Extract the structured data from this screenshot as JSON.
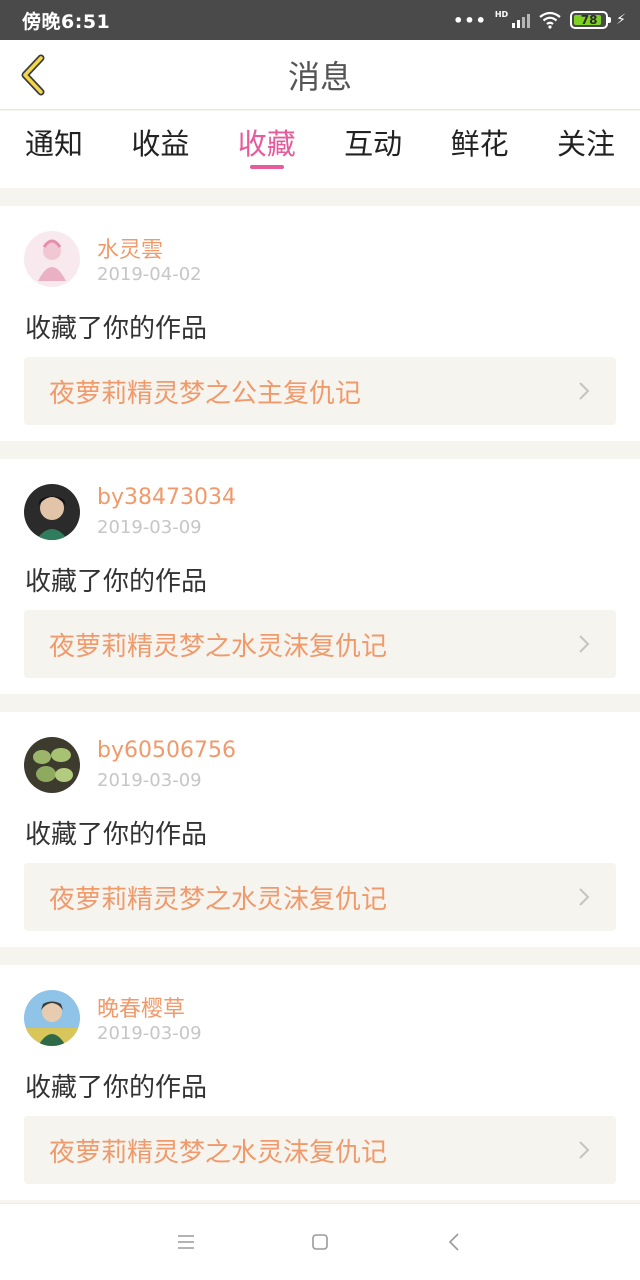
{
  "status_bar": {
    "time": "傍晚6:51",
    "dots": "•••",
    "hd": "HD",
    "battery": "78"
  },
  "header": {
    "title": "消息"
  },
  "tabs": [
    {
      "label": "通知",
      "active": false
    },
    {
      "label": "收益",
      "active": false
    },
    {
      "label": "收藏",
      "active": true
    },
    {
      "label": "互动",
      "active": false
    },
    {
      "label": "鲜花",
      "active": false
    },
    {
      "label": "关注",
      "active": false
    }
  ],
  "messages": [
    {
      "user": "水灵雲",
      "date": "2019-04-02",
      "action": "收藏了你的作品",
      "work_title": "夜萝莉精灵梦之公主复仇记"
    },
    {
      "user": "by38473034",
      "date": "2019-03-09",
      "action": "收藏了你的作品",
      "work_title": "夜萝莉精灵梦之水灵沫复仇记"
    },
    {
      "user": "by60506756",
      "date": "2019-03-09",
      "action": "收藏了你的作品",
      "work_title": "夜萝莉精灵梦之水灵沫复仇记"
    },
    {
      "user": "晚春樱草",
      "date": "2019-03-09",
      "action": "收藏了你的作品",
      "work_title": "夜萝莉精灵梦之水灵沫复仇记"
    }
  ],
  "colors": {
    "accent_pink": "#e55b9b",
    "accent_orange": "#f09a6b"
  }
}
